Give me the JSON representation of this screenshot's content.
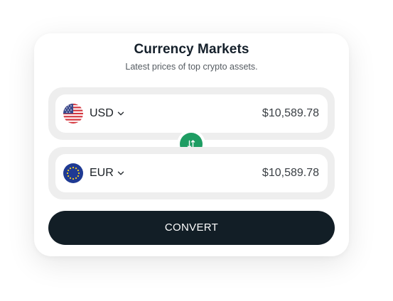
{
  "header": {
    "title": "Currency Markets",
    "subtitle": "Latest prices of top crypto assets."
  },
  "from_row": {
    "currency": "USD",
    "flag_icon": "us-flag-icon",
    "amount": "$10,589.78"
  },
  "to_row": {
    "currency": "EUR",
    "flag_icon": "eu-flag-icon",
    "amount": "$10,589.78"
  },
  "swap": {
    "icon": "swap-arrows-icon",
    "color": "#1e9d63"
  },
  "convert_button": {
    "label": "CONVERT",
    "color": "#121e26"
  }
}
